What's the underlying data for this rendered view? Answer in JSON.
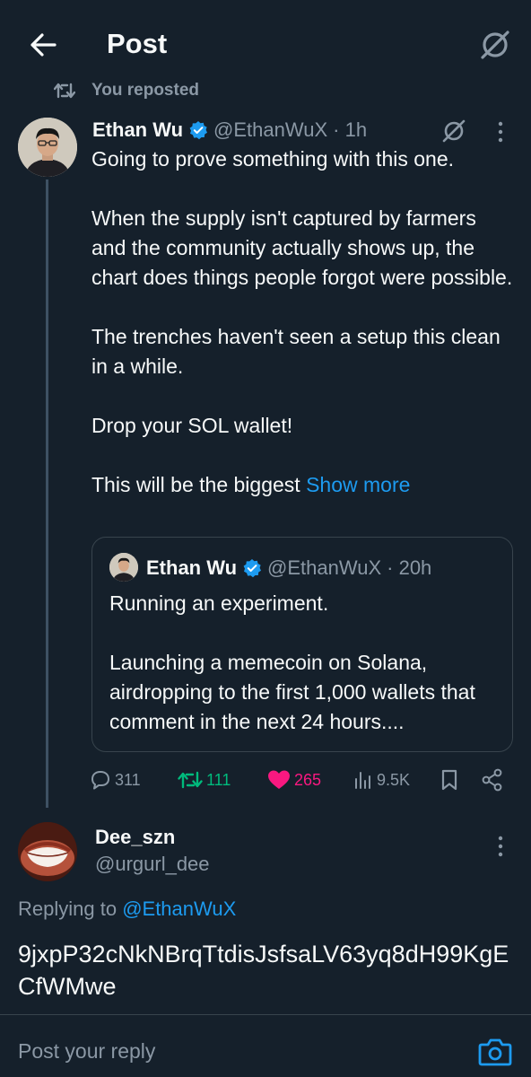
{
  "header": {
    "title": "Post",
    "back_icon": "arrow-left-icon",
    "grok_icon": "grok-icon"
  },
  "repost": {
    "icon": "repost-icon",
    "label": "You reposted"
  },
  "tweet": {
    "name": "Ethan Wu",
    "handle": "@EthanWuX",
    "time": "· 1h",
    "verified_color": "#1d9bf0",
    "paragraphs": [
      "Going to prove something with this one.",
      "When the supply isn't captured by farmers and the community actually shows up, the chart does things people forgot were possible.",
      "The trenches haven't seen a setup this clean in a while.",
      "Drop your SOL wallet!"
    ],
    "last_line": "This will be the biggest ",
    "show_more": "Show more"
  },
  "quote": {
    "name": "Ethan Wu",
    "handle": "@EthanWuX",
    "time": "· 20h",
    "paragraphs": [
      "Running an experiment.",
      "Launching a memecoin on Solana, airdropping to the first 1,000 wallets that comment in the next 24 hours...."
    ]
  },
  "actions": {
    "replies": "311",
    "reposts": "111",
    "likes": "265",
    "views": "9.5K",
    "repost_color": "#00ba7c",
    "like_color": "#f91880"
  },
  "reply": {
    "name": "Dee_szn",
    "handle": "@urgurl_dee",
    "replying_prefix": "Replying to ",
    "replying_to": "@EthanWuX",
    "text": "9jxpP32cNkNBrqTtdisJsfsaLV63yq8dH99KgECfWMwe"
  },
  "composer": {
    "placeholder": "Post your reply",
    "camera_icon": "camera-icon"
  },
  "colors": {
    "background": "#15202b",
    "accent": "#1d9bf0",
    "muted": "#8b98a5"
  }
}
